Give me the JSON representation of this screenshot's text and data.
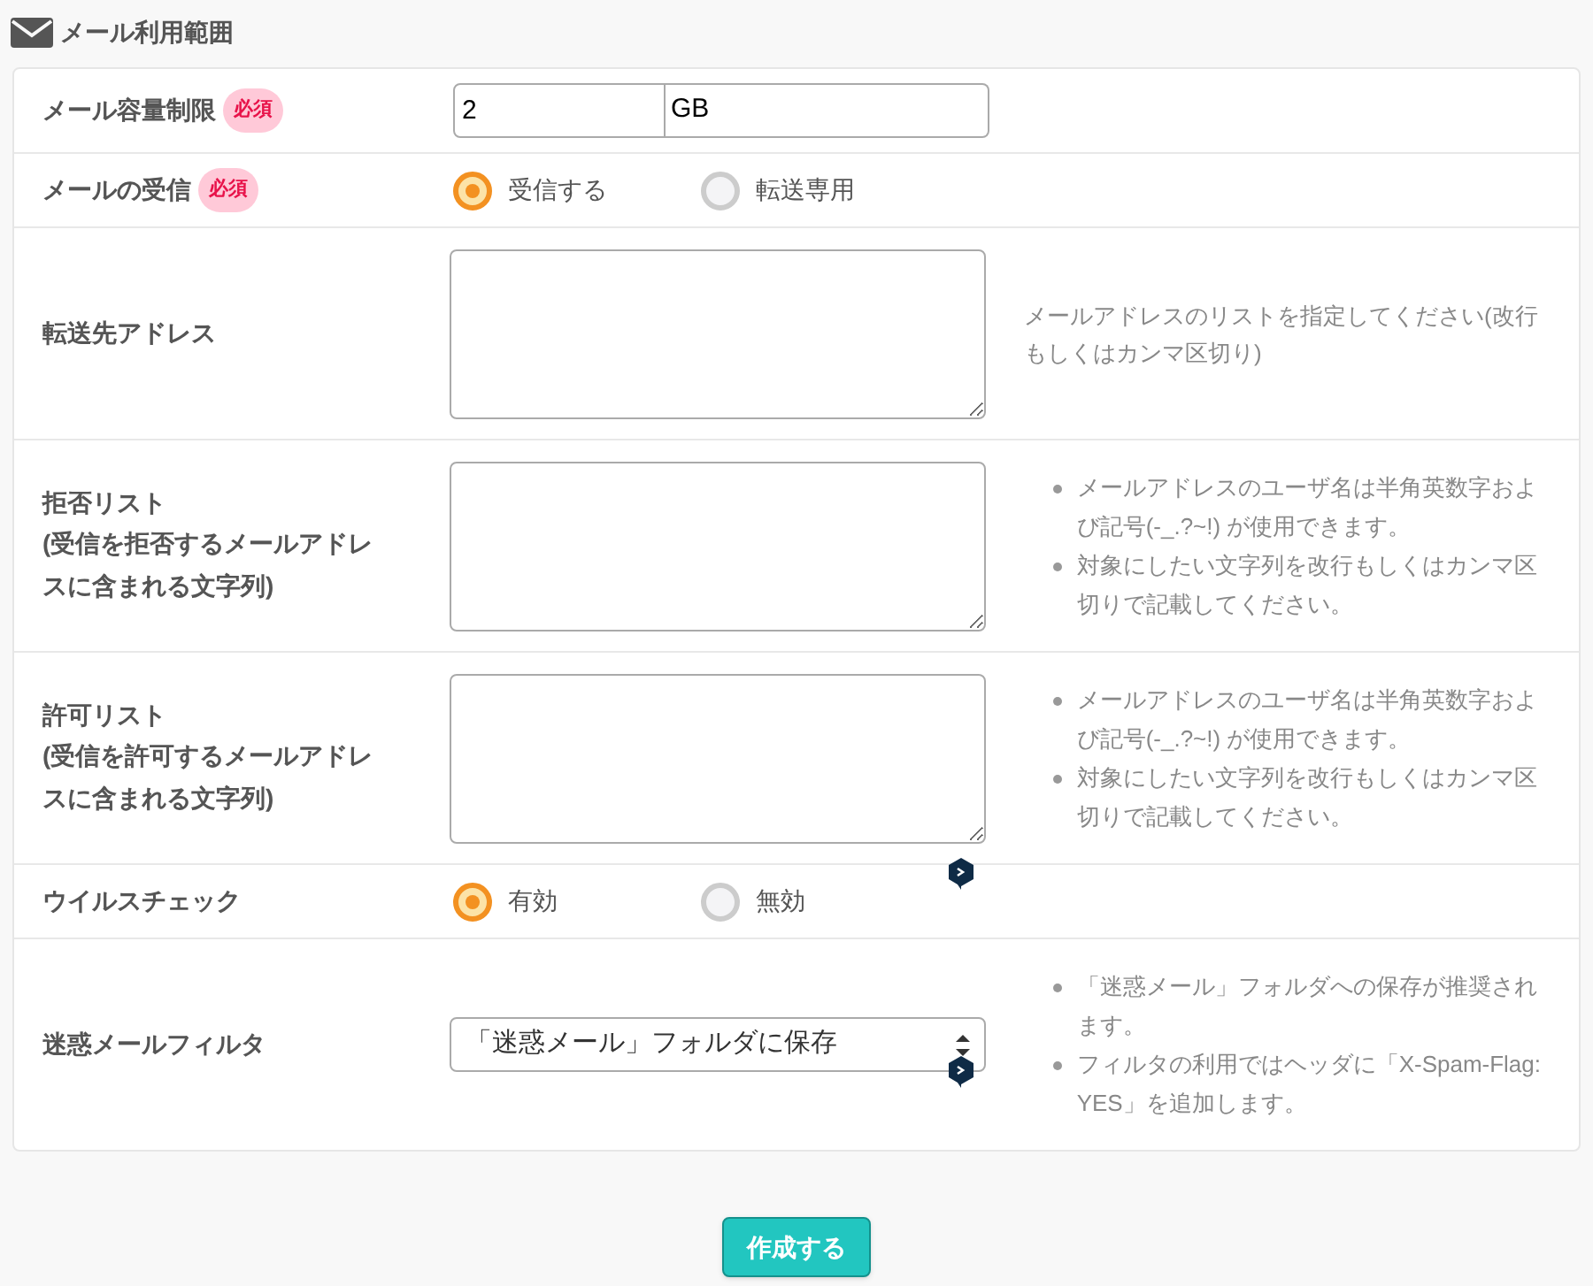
{
  "section": {
    "title": "メール利用範囲"
  },
  "rows": [
    {
      "kind": "unit_input",
      "label": "メール容量制限",
      "required": true,
      "required_label": "必須",
      "value": "2",
      "unit": "GB"
    },
    {
      "kind": "radio",
      "label": "メールの受信",
      "required": true,
      "required_label": "必須",
      "options": [
        {
          "label": "受信する",
          "selected": true
        },
        {
          "label": "転送専用",
          "selected": false
        }
      ]
    },
    {
      "kind": "textarea",
      "label": "転送先アドレス",
      "required": false,
      "hint": "メールアドレスのリストを指定してください(改行もしくはカンマ区切り)"
    },
    {
      "kind": "textarea",
      "label": "拒否リスト",
      "sublabel": "(受信を拒否するメールアドレスに含まれる文字列)",
      "required": false,
      "bullets": [
        "メールアドレスのユーザ名は半角英数字および記号(-_.?~!) が使用できます。",
        "対象にしたい文字列を改行もしくはカンマ区切りで記載してください。"
      ]
    },
    {
      "kind": "textarea",
      "label": "許可リスト",
      "sublabel": "(受信を許可するメールアドレスに含まれる文字列)",
      "required": false,
      "overlay": true,
      "bullets": [
        "メールアドレスのユーザ名は半角英数字および記号(-_.?~!) が使用できます。",
        "対象にしたい文字列を改行もしくはカンマ区切りで記載してください。"
      ]
    },
    {
      "kind": "radio",
      "label": "ウイルスチェック",
      "required": false,
      "options": [
        {
          "label": "有効",
          "selected": true
        },
        {
          "label": "無効",
          "selected": false
        }
      ]
    },
    {
      "kind": "select",
      "label": "迷惑メールフィルタ",
      "required": false,
      "overlay": true,
      "value": "「迷惑メール」フォルダに保存",
      "bullets": [
        "「迷惑メール」フォルダへの保存が推奨されます。",
        "フィルタの利用ではヘッダに「X-Spam-Flag: YES」を追加します。"
      ]
    }
  ],
  "submit": {
    "label": "作成する"
  }
}
